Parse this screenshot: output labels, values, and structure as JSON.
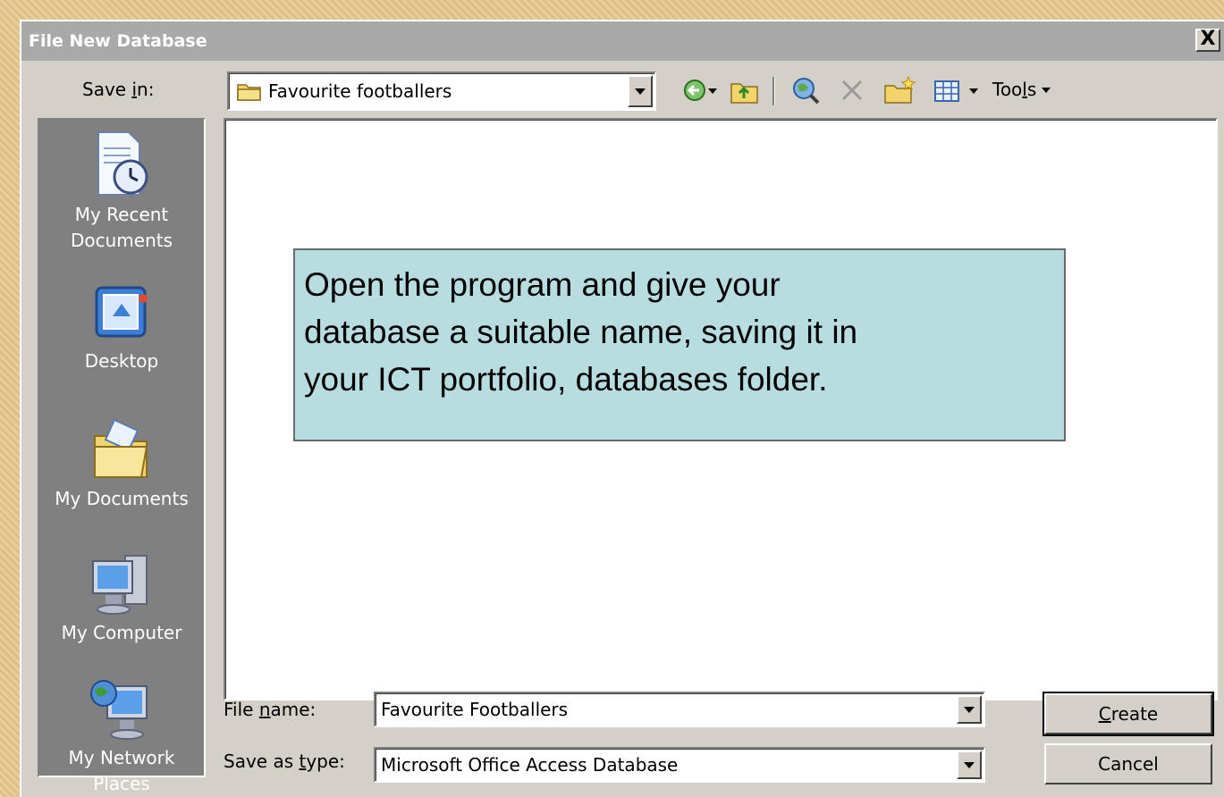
{
  "dialog": {
    "title": "File New Database",
    "close_label": "X"
  },
  "save_in": {
    "label_pre": "Save ",
    "label_key": "i",
    "label_post": "n:",
    "value": "Favourite footballers"
  },
  "toolbar": {
    "tools_pre": "Too",
    "tools_key": "l",
    "tools_post": "s"
  },
  "places": [
    {
      "line1": "My Recent",
      "line2": "Documents",
      "icon": "recent-documents-icon"
    },
    {
      "line1": "Desktop",
      "line2": "",
      "icon": "desktop-icon"
    },
    {
      "line1": "My Documents",
      "line2": "",
      "icon": "my-documents-icon"
    },
    {
      "line1": "My Computer",
      "line2": "",
      "icon": "my-computer-icon"
    },
    {
      "line1": "My Network",
      "line2": "Places",
      "icon": "my-network-places-icon"
    }
  ],
  "callout": {
    "line1": "Open the program and give your",
    "line2": "database a suitable name, saving it in",
    "line3": "your ICT portfolio, databases folder."
  },
  "file_name": {
    "label_pre": "File ",
    "label_key": "n",
    "label_post": "ame:",
    "value": "Favourite Footballers"
  },
  "save_as_type": {
    "label_pre": "Save as ",
    "label_key": "t",
    "label_post": "ype:",
    "value": "Microsoft Office Access Database"
  },
  "buttons": {
    "create_key": "C",
    "create_post": "reate",
    "cancel": "Cancel"
  },
  "colors": {
    "titlebar": "#a9a9a9",
    "dialog": "#d4d0c8",
    "callout": "#b8dde0",
    "places_bar": "#808080"
  }
}
